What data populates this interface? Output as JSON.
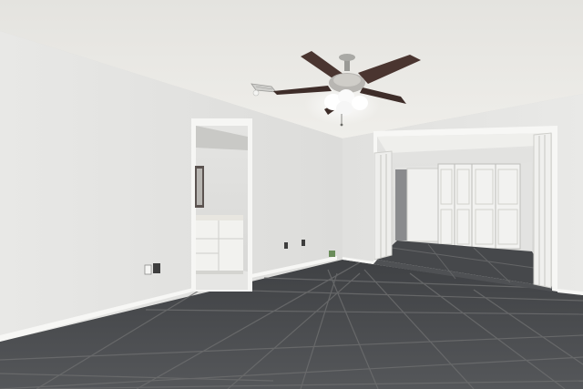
{
  "scene": {
    "kind": "photo",
    "subject": "empty-room-interior",
    "colors": {
      "ceiling": "#e9e8e4",
      "wall_left": "#e3e3e1",
      "wall_back": "#dedede",
      "wall_right": "#e6e6e4",
      "trim": "#f7f7f5",
      "floor_tile": "#4b4d50",
      "grout": "#6c6d6e",
      "fan_blade": "#4a3530",
      "closet_door": "#f2f2f0"
    },
    "elements": [
      "ceiling-fan-icon",
      "hvac-vent-icon",
      "bathroom-doorway",
      "bathroom-vanity",
      "bifold-doorway",
      "closet-doors",
      "wall-outlet-icon",
      "tile-floor"
    ]
  }
}
